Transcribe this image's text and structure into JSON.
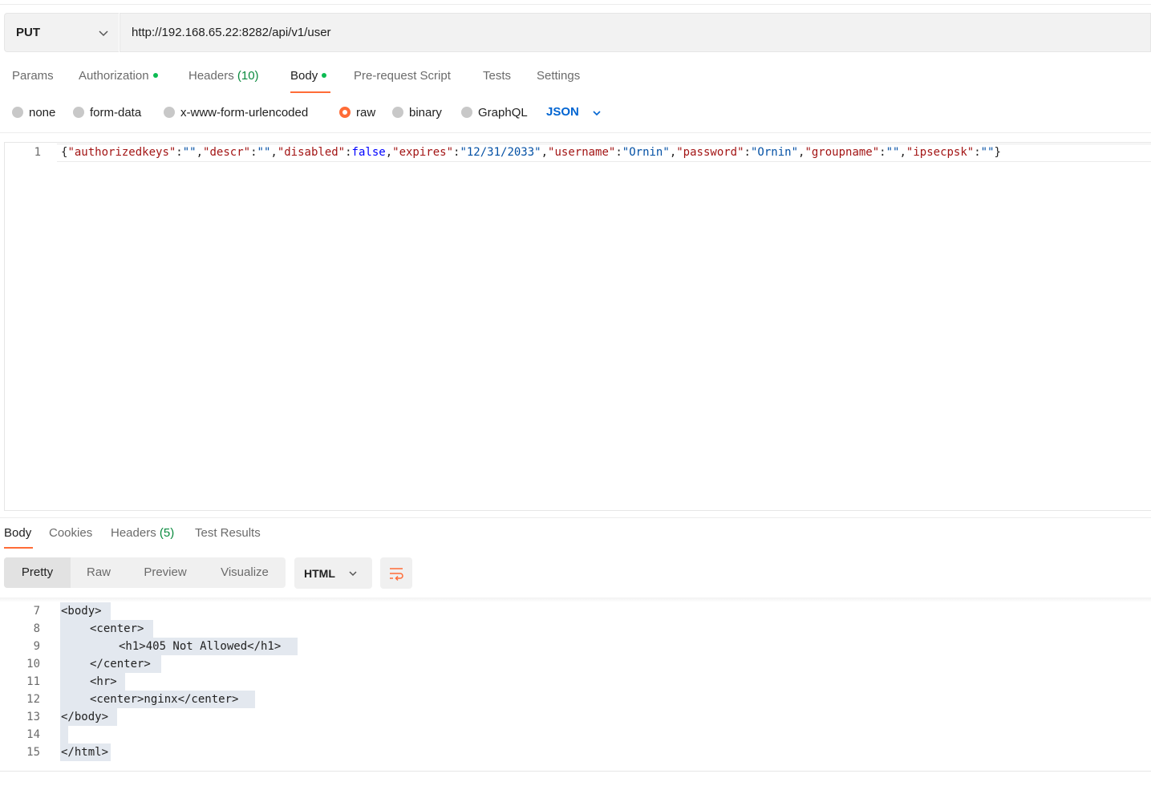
{
  "request": {
    "method": "PUT",
    "url": "http://192.168.65.22:8282/api/v1/user"
  },
  "request_tabs": {
    "params": "Params",
    "authorization": "Authorization",
    "headers": "Headers",
    "headers_count": "(10)",
    "body": "Body",
    "prerequest": "Pre-request Script",
    "tests": "Tests",
    "settings": "Settings",
    "active": "Body"
  },
  "body_types": {
    "none": "none",
    "form_data": "form-data",
    "urlencoded": "x-www-form-urlencoded",
    "raw": "raw",
    "binary": "binary",
    "graphql": "GraphQL",
    "selected": "raw",
    "language": "JSON"
  },
  "request_body": {
    "line_number": "1",
    "fields": {
      "authorizedkeys": "",
      "descr": "",
      "disabled": "false",
      "expires": "12/31/2033",
      "username": "Ornin",
      "password": "Ornin",
      "groupname": "",
      "ipsecpsk": ""
    }
  },
  "response_tabs": {
    "body": "Body",
    "cookies": "Cookies",
    "headers": "Headers",
    "headers_count": "(5)",
    "test_results": "Test Results",
    "active": "Body"
  },
  "response_view": {
    "pretty": "Pretty",
    "raw": "Raw",
    "preview": "Preview",
    "visualize": "Visualize",
    "selected": "Pretty",
    "format": "HTML"
  },
  "response_body": {
    "lines": [
      {
        "n": "7",
        "text": "<body>"
      },
      {
        "n": "8",
        "text": "<center>"
      },
      {
        "n": "9",
        "text": "<h1>405 Not Allowed</h1>"
      },
      {
        "n": "10",
        "text": "</center>"
      },
      {
        "n": "11",
        "text": "<hr>"
      },
      {
        "n": "12",
        "text": "<center>nginx</center>"
      },
      {
        "n": "13",
        "text": "</body>"
      },
      {
        "n": "14",
        "text": ""
      },
      {
        "n": "15",
        "text": "</html>"
      }
    ]
  },
  "colors": {
    "accent": "#ff6c37",
    "status_dot": "#0cbb52",
    "json_blue": "#0265d2",
    "key_red": "#a31515",
    "value_blue": "#0451a5",
    "keyword_blue": "#0000ff"
  },
  "icons": [
    "chevron-down-icon",
    "wrap-lines-icon"
  ]
}
